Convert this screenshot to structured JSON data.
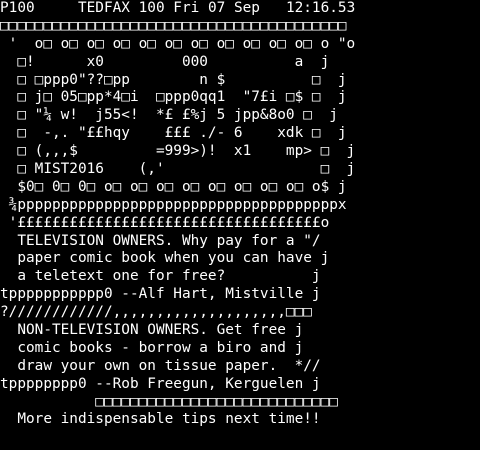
{
  "header": {
    "page_number": "P100",
    "service_name": "TEDFAX 100",
    "date": "Fri 07 Sep",
    "time": "12:16.53"
  },
  "rows": [
    "□□□□□□□□□□□□□□□□□□□□□□□□□□□□□□□□□□□□□□□□",
    " '  o□ o□ o□ o□ o□ o□ o□ o□ o□ o□ o□ o \"o",
    "  □!      x0         000          a  j",
    "  □ □ppp0\"??□pp        n $          □  j",
    "  □ j□ 05□pp*4□i  □ppp0qq1  \"7£i □$ □  j",
    "  □ \"¼ w!  j55<!  *£ £%j 5 jpp&8o0 □  j",
    "  □  -,. \"££hqy    £££ ./- 6    xdk □  j",
    "  □ (,,,$         =999>)!  x1    mp> □  j",
    "  □ MIST2016    (,'                  □  j",
    "  $0□ 0□ 0□ o□ o□ o□ o□ o□ o□ o□ o□ o$ j",
    " ¾pppppppppppppppppppppppppppppppppppppx",
    " '£££££££££££££££££££££££££££££££££££o",
    "  TELEVISION OWNERS. Why pay for a \"/",
    "  paper comic book when you can have j",
    "  a teletext one for free?          j",
    "tppppppppppp0 --Alf Hart, Mistville j",
    "?////////////,,,,,,,,,,,,,,,,,,,,□□□",
    "  NON-TELEVISION OWNERS. Get free j",
    "  comic books - borrow a biro and j",
    "  draw your own on tissue paper.  *//",
    "tpppppppp0 --Rob Freegun, Kerguelen j",
    "           □□□□□□□□□□□□□□□□□□□□□□□□□□□□",
    "  More indispensable tips next time!!"
  ]
}
